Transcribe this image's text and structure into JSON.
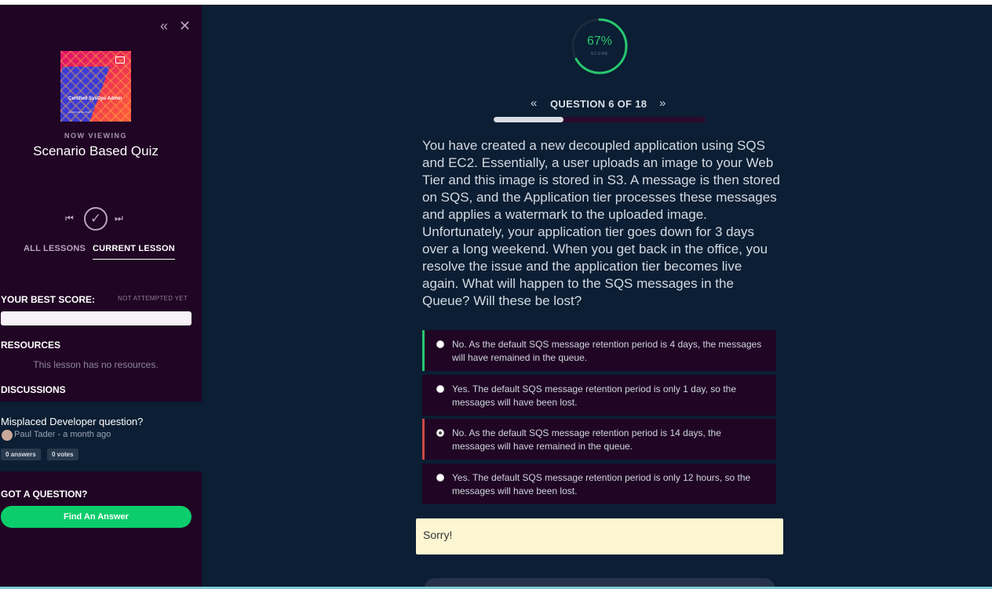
{
  "sidebar": {
    "collapse_icon": "double-chevron-left-icon",
    "close_icon": "close-icon",
    "course_cover": {
      "title": "Certified SysOps Admin",
      "subtitle": "ASSOCIATE 2019"
    },
    "now_viewing_label": "NOW VIEWING",
    "course_title": "Scenario Based Quiz",
    "tabs": [
      {
        "label": "ALL LESSONS",
        "active": false
      },
      {
        "label": "CURRENT LESSON",
        "active": true
      }
    ],
    "best_score": {
      "label": "YOUR BEST SCORE:",
      "status": "NOT ATTEMPTED YET"
    },
    "resources": {
      "label": "RESOURCES",
      "empty_text": "This lesson has no resources."
    },
    "discussions": {
      "label": "DISCUSSIONS",
      "items": [
        {
          "title": "Misplaced Developer question?",
          "meta": "Paul Tader - a month ago",
          "answers": "0 answers",
          "votes": "0 votes"
        }
      ]
    },
    "got_question": {
      "label": "GOT A QUESTION?",
      "button_label": "Find An Answer"
    }
  },
  "main": {
    "score": {
      "percent": "67%",
      "label": "SCORE",
      "value": 0.67,
      "color": "#28c76f"
    },
    "question_nav": {
      "label": "QUESTION 6 OF 18",
      "progress": 0.33
    },
    "question_text": "You have created a new decoupled application using SQS and EC2. Essentially, a user uploads an image to your Web Tier and this image is stored in S3. A message is then stored on SQS, and the Application tier processes these messages and applies a watermark to the uploaded image. Unfortunately, your application tier goes down for 3 days over a long weekend. When you get back in the office, you resolve the issue and the application tier becomes live again. What will happen to the SQS messages in the Queue? Will these be lost?",
    "options": [
      {
        "text": "No. As the default SQS message retention period is 4 days, the messages will have remained in the queue.",
        "state": "correct",
        "selected": false
      },
      {
        "text": "Yes. The default SQS message retention period is only 1 day, so the messages will have been lost.",
        "state": "neutral",
        "selected": false
      },
      {
        "text": "No. As the default SQS message retention period is 14 days, the messages will have remained in the queue.",
        "state": "wrong",
        "selected": true
      },
      {
        "text": "Yes. The default SQS message retention period is only 12 hours, so the messages will have been lost.",
        "state": "neutral",
        "selected": false
      }
    ],
    "feedback": "Sorry!",
    "colors": {
      "correct": "#28c76f",
      "wrong": "#d04848",
      "sidebar_bg": "#200524",
      "main_bg": "#0b1e33",
      "cta": "#0ccd6b"
    }
  }
}
